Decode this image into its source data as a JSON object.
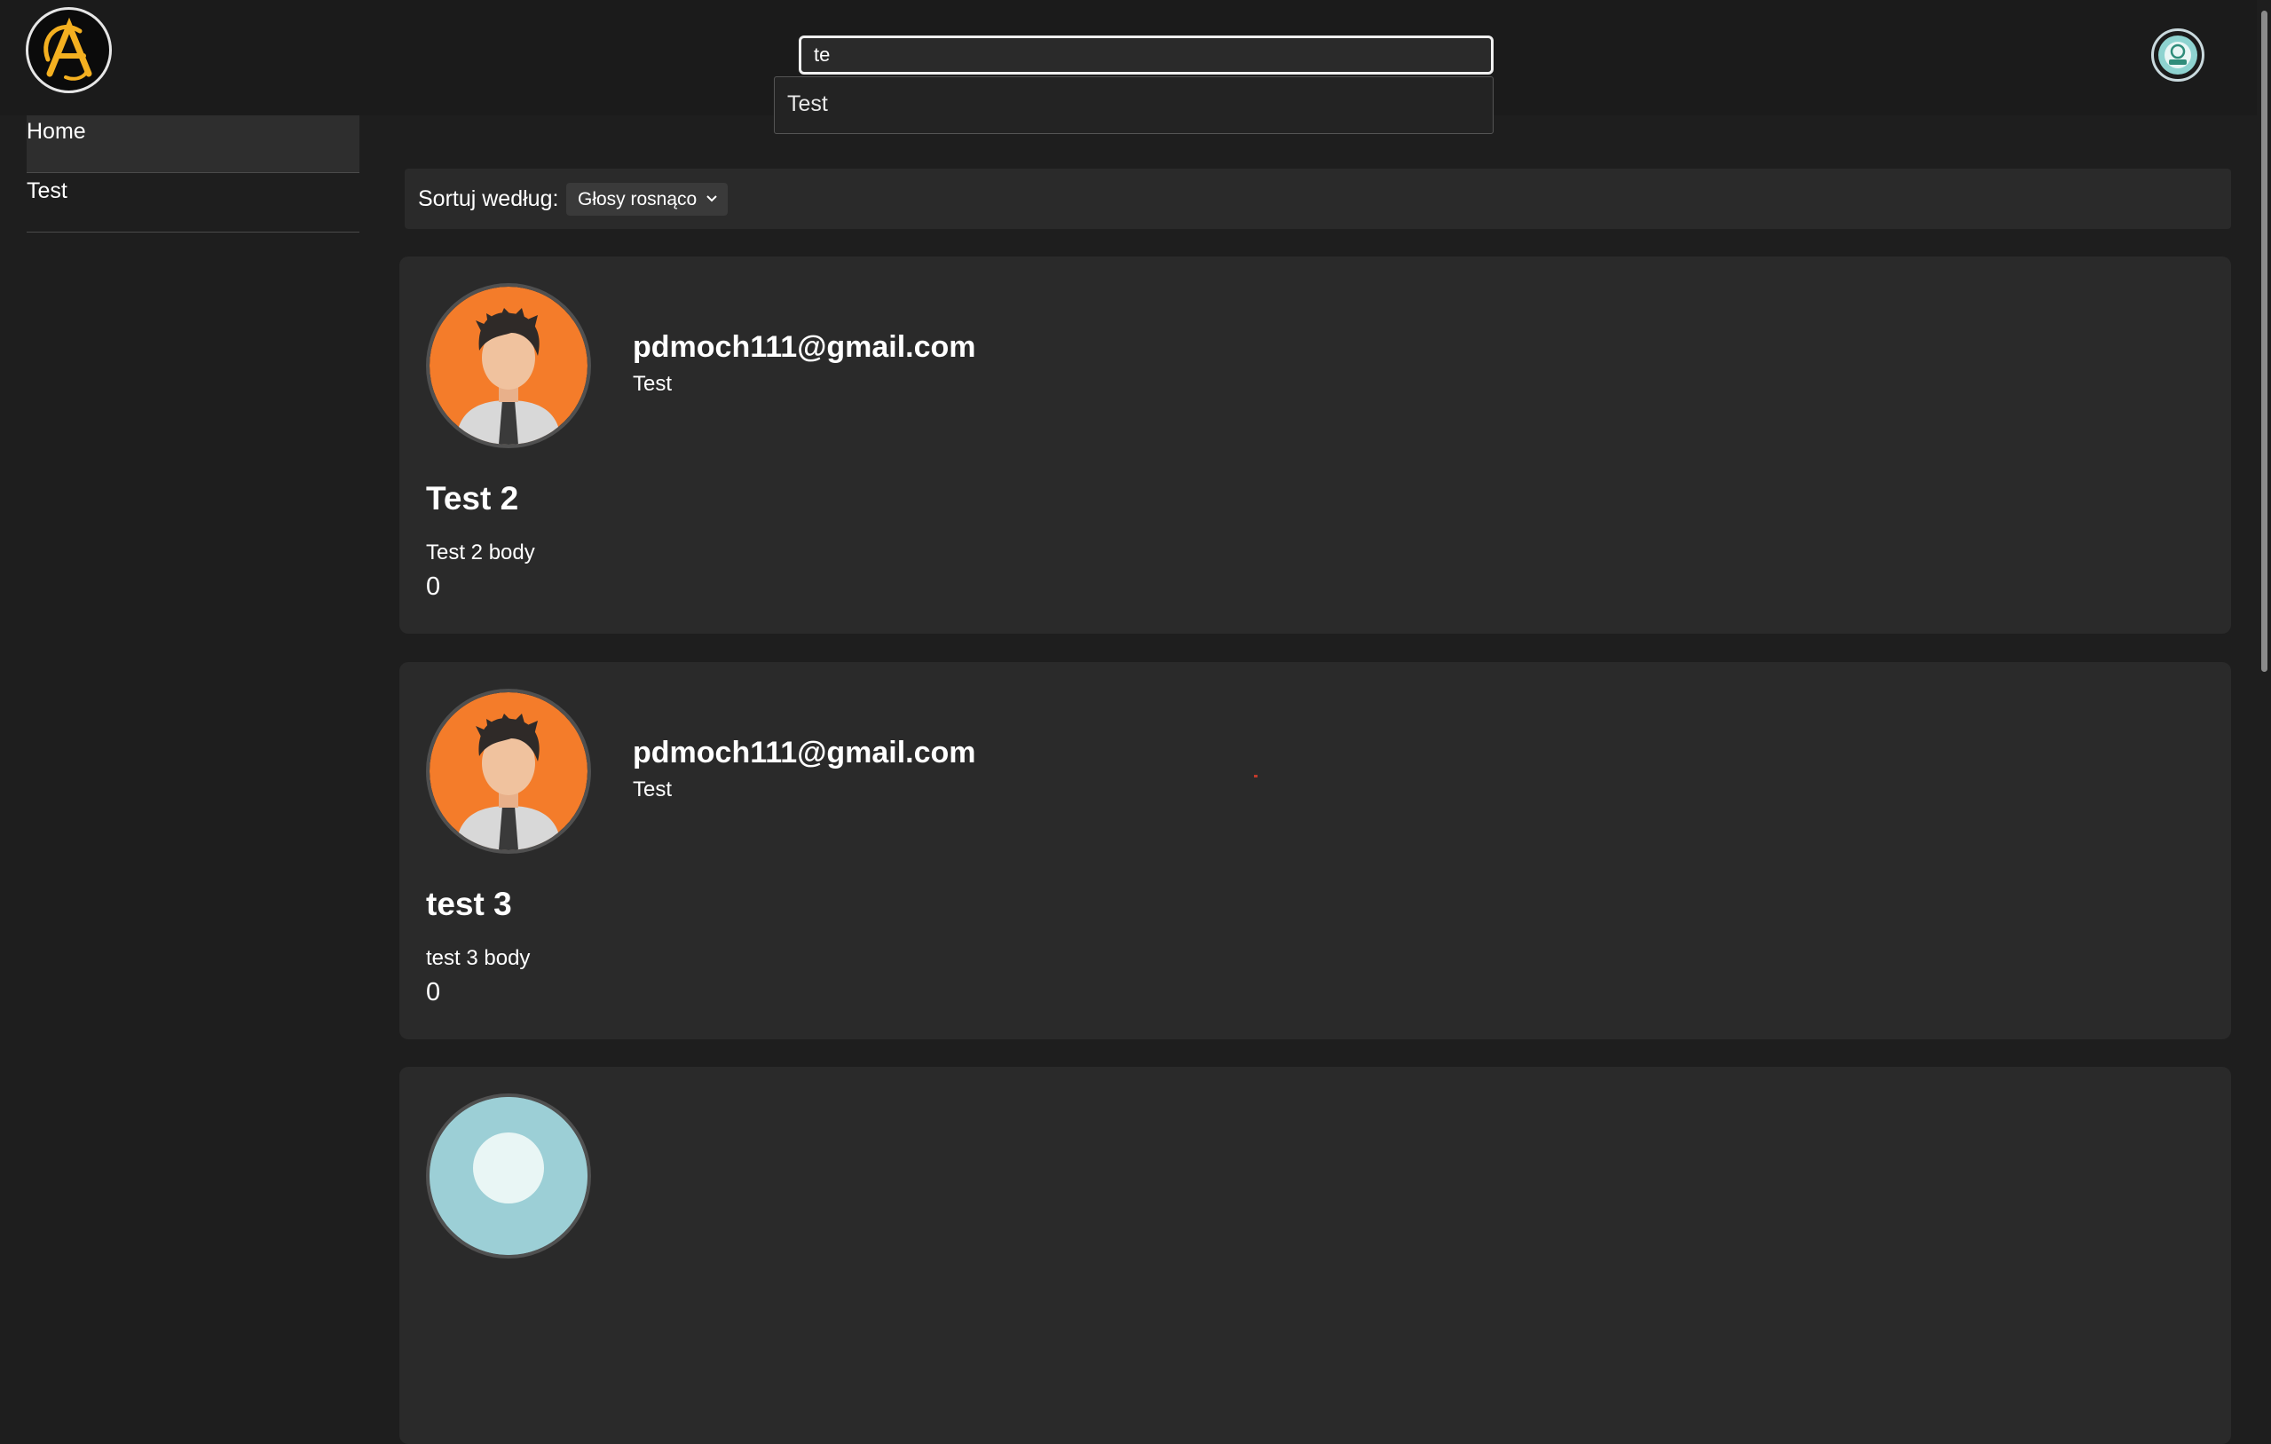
{
  "header": {
    "logo_icon": "anime-a-logo-icon",
    "search": {
      "value": "te",
      "placeholder": ""
    },
    "suggestions": [
      {
        "label": "Test"
      }
    ],
    "user_avatar_icon": "forum-avatar-icon"
  },
  "sidebar": {
    "items": [
      {
        "label": "Home",
        "active": true
      },
      {
        "label": "Test",
        "active": false
      }
    ]
  },
  "sort": {
    "label": "Sortuj według:",
    "selected": "Głosy rosnąco"
  },
  "posts": [
    {
      "author": "pdmoch111@gmail.com",
      "category": "Test",
      "title": "Test 2",
      "body": "Test 2 body",
      "votes": "0",
      "avatar_icon": "male-avatar-icon"
    },
    {
      "author": "pdmoch111@gmail.com",
      "category": "Test",
      "title": "test 3",
      "body": "test 3 body",
      "votes": "0",
      "avatar_icon": "male-avatar-icon"
    }
  ],
  "colors": {
    "background": "#1e1e1e",
    "card": "#2a2a2a",
    "accent": "#f4c542",
    "avatar_orange": "#f47c2a"
  }
}
